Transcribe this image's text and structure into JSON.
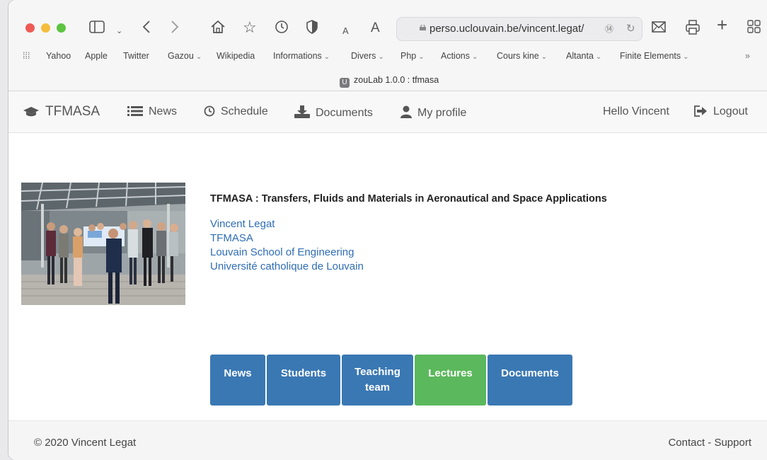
{
  "browser": {
    "url": "perso.uclouvain.be/vincent.legat/",
    "tab_title": "zouLab 1.0.0 : tfmasa",
    "tab_favicon_letter": "U",
    "bookmarks": [
      {
        "label": "Yahoo",
        "chevron": false
      },
      {
        "label": "Apple",
        "chevron": false
      },
      {
        "label": "Twitter",
        "chevron": false
      },
      {
        "label": "Gazou",
        "chevron": true
      },
      {
        "label": "Wikipedia",
        "chevron": false
      },
      {
        "label": "Informations",
        "chevron": true
      },
      {
        "label": "Divers",
        "chevron": true
      },
      {
        "label": "Php",
        "chevron": true
      },
      {
        "label": "Actions",
        "chevron": true
      },
      {
        "label": "Cours kine",
        "chevron": true
      },
      {
        "label": "Altanta",
        "chevron": true
      },
      {
        "label": "Finite Elements",
        "chevron": true
      }
    ],
    "overflow": "»"
  },
  "navbar": {
    "brand": "TFMASA",
    "news": "News",
    "schedule": "Schedule",
    "documents": "Documents",
    "profile": "My profile",
    "greeting": "Hello Vincent",
    "logout": "Logout"
  },
  "main": {
    "headline": "TFMASA : Transfers, Fluids and Materials in Aeronautical and Space Applications",
    "links": [
      "Vincent Legat",
      "TFMASA",
      "Louvain School of Engineering",
      "Université catholique de Louvain"
    ],
    "tiles": [
      {
        "label": "News",
        "color": "#3a78b3"
      },
      {
        "label": "Students",
        "color": "#3a78b3"
      },
      {
        "label": "Teaching team",
        "color": "#3a78b3"
      },
      {
        "label": "Lectures",
        "color": "#5cb85c"
      },
      {
        "label": "Documents",
        "color": "#3a78b3"
      }
    ]
  },
  "footer": {
    "copyright": "© 2020 Vincent Legat",
    "contact": "Contact - Support"
  },
  "colors": {
    "link": "#2f6db4",
    "tile_blue": "#3a78b3",
    "tile_green": "#5cb85c"
  }
}
